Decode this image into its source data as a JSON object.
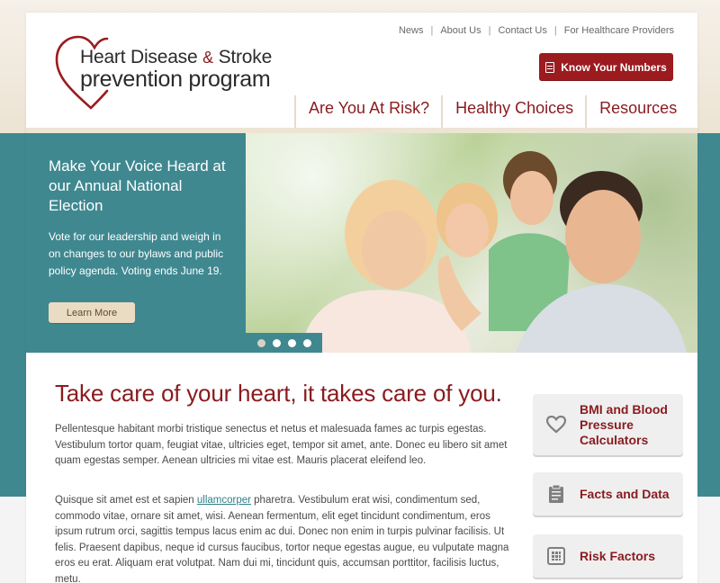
{
  "logo": {
    "line1_part1": "Heart Disease",
    "line1_amp": "&",
    "line1_part2": "Stroke",
    "line2": "prevention program"
  },
  "utility_nav": [
    "News",
    "About Us",
    "Contact Us",
    "For Healthcare Providers"
  ],
  "utility_sep": "|",
  "cta_button": {
    "label": "Know Your Numbers",
    "icon": "document-icon"
  },
  "main_nav": [
    "Are You At Risk?",
    "Healthy Choices",
    "Resources"
  ],
  "hero": {
    "title": "Make Your Voice Heard at our Annual National Election",
    "text": "Vote for our leadership and weigh in on changes to our bylaws and public policy agenda. Voting ends June 19.",
    "button": "Learn More",
    "slide_count": 4,
    "active_slide": 1
  },
  "content": {
    "title": "Take care of your heart, it takes care of you.",
    "para1": "Pellentesque habitant morbi tristique senectus et netus et malesuada fames ac turpis egestas. Vestibulum tortor quam, feugiat vitae, ultricies eget, tempor sit amet, ante. Donec eu libero sit amet quam egestas semper. Aenean ultricies mi vitae est. Mauris placerat eleifend leo.",
    "para2_before": "Quisque sit amet est et sapien ",
    "para2_link": "ullamcorper",
    "para2_after": " pharetra. Vestibulum erat wisi, condimentum sed, commodo vitae, ornare sit amet, wisi. Aenean fermentum, elit eget tincidunt condimentum, eros ipsum rutrum orci, sagittis tempus lacus enim ac dui. Donec non enim in turpis pulvinar facilisis. Ut felis. Praesent dapibus, neque id cursus faucibus, tortor neque egestas augue, eu vulputate magna eros eu erat. Aliquam erat volutpat. Nam dui mi, tincidunt quis, accumsan porttitor, facilisis luctus, metu."
  },
  "sidebar": [
    {
      "label": "BMI and Blood Pressure Calculators",
      "icon": "heart-icon"
    },
    {
      "label": "Facts and Data",
      "icon": "clipboard-icon"
    },
    {
      "label": "Risk Factors",
      "icon": "calculator-icon"
    }
  ],
  "colors": {
    "brand_red": "#9b1b1f",
    "teal": "#3f8890",
    "beige": "#eadcc2"
  }
}
